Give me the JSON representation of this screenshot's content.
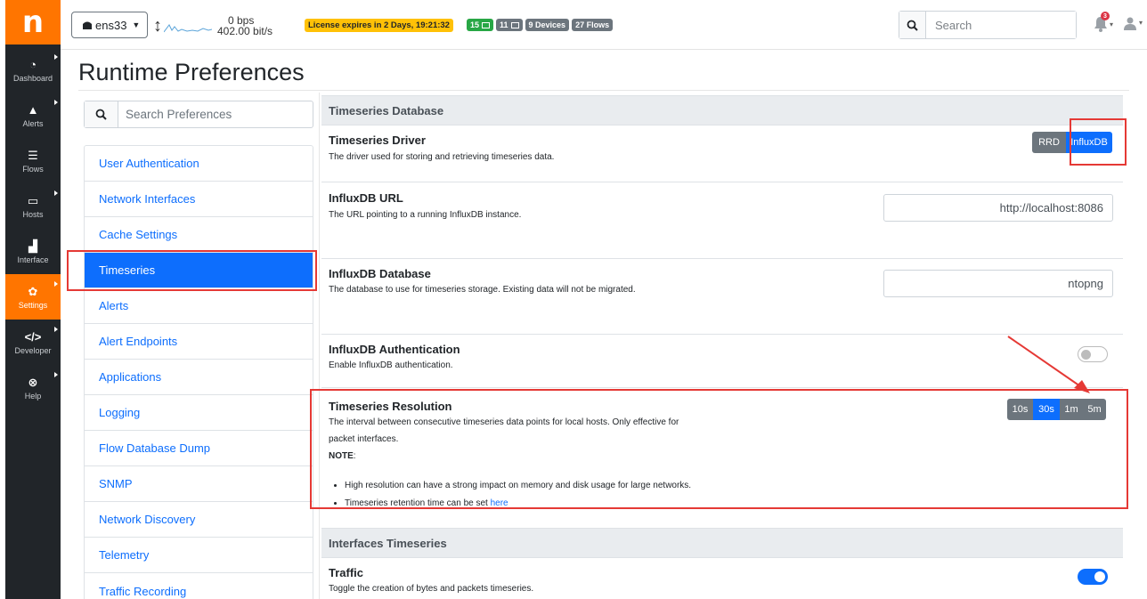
{
  "app": {
    "logo": "n"
  },
  "sidebar": {
    "items": [
      {
        "label": "Dashboard",
        "icon": "gauge-icon",
        "glyph": "◔"
      },
      {
        "label": "Alerts",
        "icon": "warning-icon",
        "glyph": "▲"
      },
      {
        "label": "Flows",
        "icon": "flows-icon",
        "glyph": "☰"
      },
      {
        "label": "Hosts",
        "icon": "laptop-icon",
        "glyph": "▭"
      },
      {
        "label": "Interface",
        "icon": "ethernet-icon",
        "glyph": "▟"
      },
      {
        "label": "Settings",
        "icon": "gear-icon",
        "glyph": "✿"
      },
      {
        "label": "Developer",
        "icon": "code-icon",
        "glyph": "</>"
      },
      {
        "label": "Help",
        "icon": "lifebuoy-icon",
        "glyph": "⊗"
      }
    ]
  },
  "topbar": {
    "interface": "ens33",
    "traffic_up": "0 bps",
    "traffic_down": "402.00 bit/s",
    "license": "License expires in 2 Days, 19:21:32",
    "badges": {
      "local_hosts": "15",
      "remote_hosts": "11",
      "devices": "9 Devices",
      "flows": "27 Flows"
    },
    "search_placeholder": "Search",
    "alert_count": "3"
  },
  "page": {
    "title": "Runtime Preferences"
  },
  "prefs": {
    "search_placeholder": "Search Preferences",
    "items": [
      "User Authentication",
      "Network Interfaces",
      "Cache Settings",
      "Timeseries",
      "Alerts",
      "Alert Endpoints",
      "Applications",
      "Logging",
      "Flow Database Dump",
      "SNMP",
      "Network Discovery",
      "Telemetry",
      "Traffic Recording"
    ],
    "active": "Timeseries"
  },
  "content": {
    "section1": "Timeseries Database",
    "driver": {
      "title": "Timeseries Driver",
      "desc": "The driver used for storing and retrieving timeseries data.",
      "options": [
        "RRD",
        "InfluxDB"
      ],
      "selected": "InfluxDB"
    },
    "influx_url": {
      "title": "InfluxDB URL",
      "desc": "The URL pointing to a running InfluxDB instance.",
      "value": "http://localhost:8086"
    },
    "influx_db": {
      "title": "InfluxDB Database",
      "desc": "The database to use for timeseries storage. Existing data will not be migrated.",
      "value": "ntopng"
    },
    "influx_auth": {
      "title": "InfluxDB Authentication",
      "desc": "Enable InfluxDB authentication.",
      "enabled": false
    },
    "resolution": {
      "title": "Timeseries Resolution",
      "desc_line1": "The interval between consecutive timeseries data points for local hosts. Only effective for",
      "desc_line2": "packet interfaces.",
      "note_label": "NOTE",
      "note_colon": ":",
      "bullet1": "High resolution can have a strong impact on memory and disk usage for large networks.",
      "bullet2_text": "Timeseries retention time can be set ",
      "bullet2_link": "here",
      "options": [
        "10s",
        "30s",
        "1m",
        "5m"
      ],
      "selected": "30s"
    },
    "section2": "Interfaces Timeseries",
    "traffic": {
      "title": "Traffic",
      "desc": "Toggle the creation of bytes and packets timeseries.",
      "enabled": true
    }
  },
  "colors": {
    "brand": "#ff7500",
    "primary": "#0d6efd",
    "highlight": "#e53935"
  }
}
